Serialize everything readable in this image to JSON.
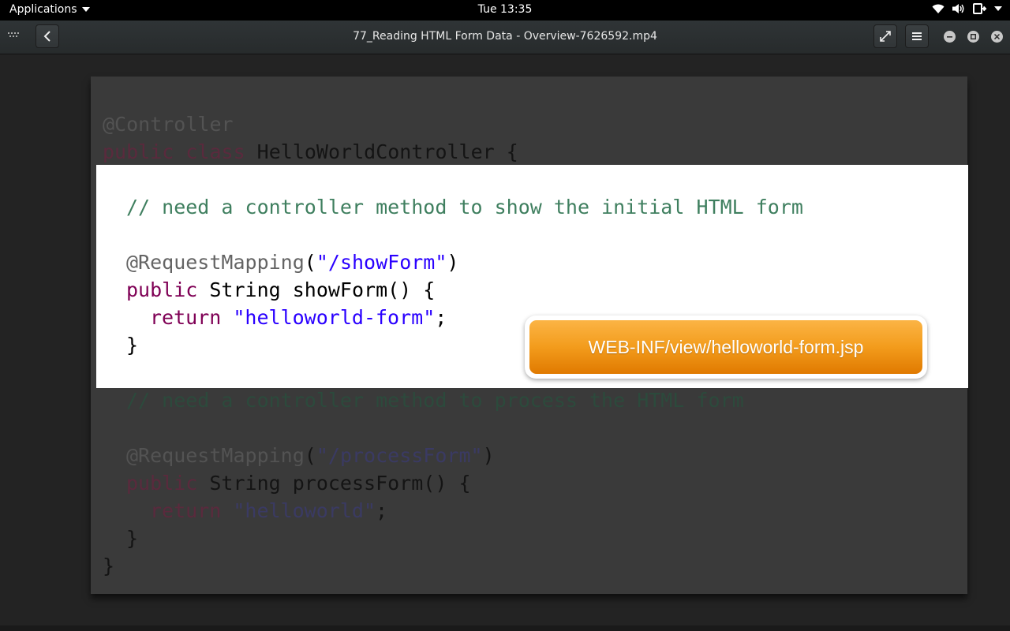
{
  "topbar": {
    "applications_label": "Applications",
    "clock": "Tue 13:35",
    "icons": [
      "wifi-icon",
      "volume-icon",
      "power-icon",
      "chevron-down-icon"
    ]
  },
  "header": {
    "title": "77_Reading HTML Form Data - Overview-7626592.mp4",
    "icons": [
      "back-icon",
      "fullscreen-icon",
      "menu-icon",
      "minimize-icon",
      "maximize-icon",
      "close-icon"
    ]
  },
  "slide": {
    "line1_annotation": "@Controller",
    "line2_kw": "public class",
    "line2_rest": " HelloWorldController {",
    "show_comment": "// need a controller method to show the initial HTML form",
    "show_mapping_ann": "@RequestMapping",
    "show_mapping_open": "(",
    "show_mapping_str": "\"/showForm\"",
    "show_mapping_close": ")",
    "show_sig_kw": "public",
    "show_sig_rest": " String showForm() {",
    "show_return_kw": "return",
    "show_return_str": "\"helloworld-form\"",
    "show_return_end": ";",
    "show_close": "}",
    "process_comment": "// need a controller method to process the HTML form",
    "process_mapping_ann": "@RequestMapping",
    "process_mapping_open": "(",
    "process_mapping_str": "\"/processForm\"",
    "process_mapping_close": ")",
    "process_sig_kw": "public",
    "process_sig_rest": " String processForm() {",
    "process_return_kw": "return",
    "process_return_str": "\"helloworld\"",
    "process_return_end": ";",
    "process_close": "}",
    "class_close": "}",
    "callout": "WEB-INF/view/helloworld-form.jsp"
  },
  "colors": {
    "keyword": "#7f0055",
    "comment": "#3f7f5f",
    "string": "#2a00ff",
    "annotation": "#646464",
    "callout": "#f39c1c"
  }
}
